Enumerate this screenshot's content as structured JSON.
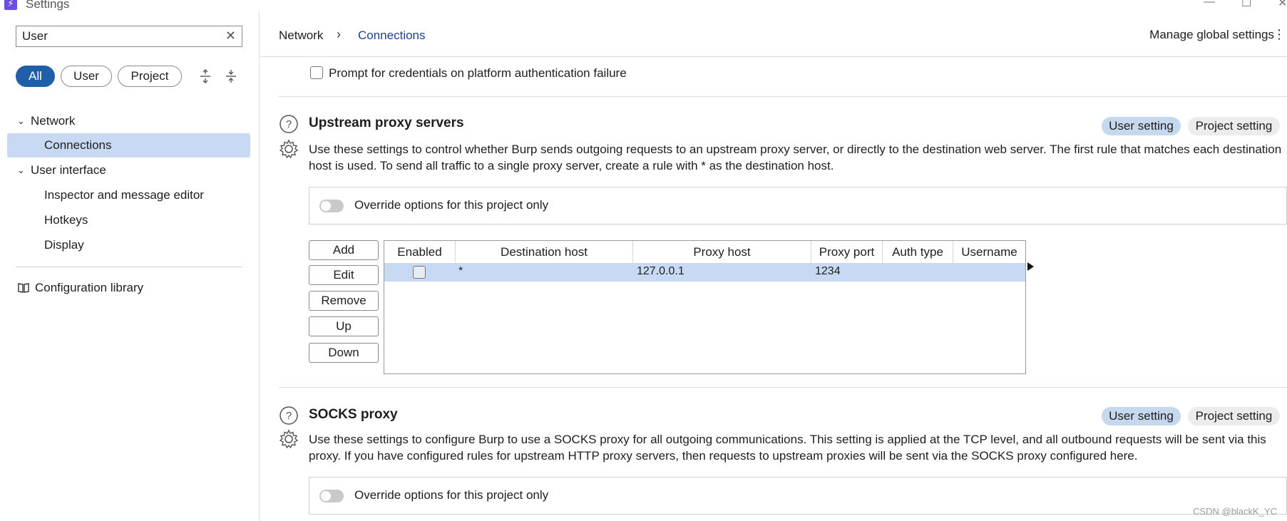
{
  "window": {
    "title": "Settings",
    "icon": "burp-lightning-icon",
    "min": "—",
    "max": "☐",
    "close": "✕"
  },
  "sidebar": {
    "search_value": "User",
    "search_clear": "✕",
    "filters": [
      {
        "label": "All",
        "active": true
      },
      {
        "label": "User",
        "active": false
      },
      {
        "label": "Project",
        "active": false
      }
    ],
    "items": [
      {
        "label": "Network",
        "chevron": "⌄"
      },
      {
        "label": "Connections"
      },
      {
        "label": "User interface",
        "chevron": "⌄"
      },
      {
        "label": "Inspector and message editor"
      },
      {
        "label": "Hotkeys"
      },
      {
        "label": "Display"
      },
      {
        "label": "Configuration library"
      }
    ]
  },
  "header": {
    "crumb_parent": "Network",
    "crumb_sep": "›",
    "crumb_current": "Connections",
    "manage_label": "Manage global settings",
    "kebab": "⋮"
  },
  "content": {
    "prompt_credentials_label": "Prompt for credentials on platform authentication failure",
    "upstream": {
      "title": "Upstream proxy servers",
      "user_tag": "User setting",
      "project_tag": "Project setting",
      "description": "Use these settings to  control whether Burp sends outgoing requests to an upstream proxy server, or directly to the destination web server. The first rule that matches each destination host is used. To send all traffic to a single proxy server, create a rule with * as the destination host.",
      "override_label": "Override options for this project only",
      "buttons": {
        "add": "Add",
        "edit": "Edit",
        "remove": "Remove",
        "up": "Up",
        "down": "Down"
      },
      "columns": [
        "Enabled",
        "Destination host",
        "Proxy host",
        "Proxy port",
        "Auth type",
        "Username"
      ],
      "rows": [
        {
          "enabled": false,
          "destination_host": "*",
          "proxy_host": "127.0.0.1",
          "proxy_port": "1234",
          "auth_type": "",
          "username": ""
        }
      ]
    },
    "socks": {
      "title": "SOCKS proxy",
      "user_tag": "User setting",
      "project_tag": "Project setting",
      "description": "Use these settings to configure Burp to use a SOCKS proxy for all outgoing communications. This setting is applied at the TCP level, and all outbound requests will be sent via this proxy. If you have configured rules for upstream HTTP proxy servers, then requests to upstream proxies will be sent via the SOCKS proxy configured here.",
      "override_label": "Override options for this project only"
    }
  },
  "watermark": "CSDN @blackK_YC",
  "colors": {
    "accent": "#1f5ea8",
    "selection": "#c8daf3",
    "user_tag": "#c6d8ee",
    "crumb_link": "#1f3f8a"
  }
}
